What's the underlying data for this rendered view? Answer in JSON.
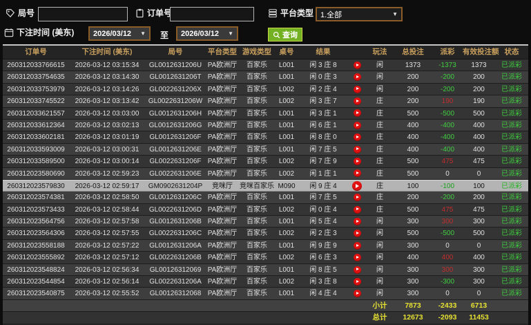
{
  "filters": {
    "round_label": "局号",
    "order_label": "订单号",
    "platform_label": "平台类型",
    "platform_value": "1.全部",
    "bet_time_label": "下注时间 (美东)",
    "date_from": "2026/03/12",
    "date_to": "2026/03/12",
    "to_label": "至",
    "search_label": "查询"
  },
  "icons": {
    "round": "tag-icon",
    "order": "clipboard-icon",
    "platform": "database-icon",
    "bet_time": "calendar-icon",
    "search": "magnifier-icon",
    "result_row": "play-icon",
    "select": "chevron-down-icon"
  },
  "colors": {
    "header_text": "#c9a05e",
    "win_red": "#c22c2c",
    "lose_green": "#3fcf3f",
    "status_green": "#3fcf3f",
    "totals_yellow": "#e5e032",
    "date_border": "#8a5c28",
    "search_green": "#74b122",
    "highlight_row": "#b4b4b4"
  },
  "table": {
    "headers": [
      "订单号",
      "下注时间 (美东)",
      "局号",
      "平台类型",
      "游戏类型",
      "桌号",
      "结果",
      "",
      "玩法",
      "总投注",
      "派彩",
      "有效投注额",
      "状态"
    ],
    "highlighted_row_index": 10,
    "rows": [
      {
        "order": "260312033766615",
        "time": "2026-03-12 03:15:34",
        "round": "GL0012631206U",
        "platform": "PA欧洲厅",
        "game": "百家乐",
        "table": "L001",
        "result": "闲 3 庄 8",
        "playtype": "闲",
        "bet": "1373",
        "payout": "-1373",
        "valid": "1373",
        "status": "已派彩"
      },
      {
        "order": "260312033754635",
        "time": "2026-03-12 03:14:30",
        "round": "GL0012631206T",
        "platform": "PA欧洲厅",
        "game": "百家乐",
        "table": "L001",
        "result": "闲 0 庄 3",
        "playtype": "闲",
        "bet": "200",
        "payout": "-200",
        "valid": "200",
        "status": "已派彩"
      },
      {
        "order": "260312033753979",
        "time": "2026-03-12 03:14:26",
        "round": "GL0022631206X",
        "platform": "PA欧洲厅",
        "game": "百家乐",
        "table": "L002",
        "result": "闲 2 庄 4",
        "playtype": "闲",
        "bet": "200",
        "payout": "-200",
        "valid": "200",
        "status": "已派彩"
      },
      {
        "order": "260312033745522",
        "time": "2026-03-12 03:13:42",
        "round": "GL0022631206W",
        "platform": "PA欧洲厅",
        "game": "百家乐",
        "table": "L002",
        "result": "闲 3 庄 7",
        "playtype": "庄",
        "bet": "200",
        "payout": "190",
        "valid": "190",
        "status": "已派彩"
      },
      {
        "order": "260312033621557",
        "time": "2026-03-12 03:03:00",
        "round": "GL0012631206H",
        "platform": "PA欧洲厅",
        "game": "百家乐",
        "table": "L001",
        "result": "闲 3 庄 1",
        "playtype": "庄",
        "bet": "500",
        "payout": "-500",
        "valid": "500",
        "status": "已派彩"
      },
      {
        "order": "260312033612364",
        "time": "2026-03-12 03:02:13",
        "round": "GL0012631206G",
        "platform": "PA欧洲厅",
        "game": "百家乐",
        "table": "L001",
        "result": "闲 6 庄 1",
        "playtype": "庄",
        "bet": "400",
        "payout": "-400",
        "valid": "400",
        "status": "已派彩"
      },
      {
        "order": "260312033602181",
        "time": "2026-03-12 03:01:19",
        "round": "GL0012631206F",
        "platform": "PA欧洲厅",
        "game": "百家乐",
        "table": "L001",
        "result": "闲 8 庄 0",
        "playtype": "庄",
        "bet": "400",
        "payout": "-400",
        "valid": "400",
        "status": "已派彩"
      },
      {
        "order": "260312033593009",
        "time": "2026-03-12 03:00:31",
        "round": "GL0012631206E",
        "platform": "PA欧洲厅",
        "game": "百家乐",
        "table": "L001",
        "result": "闲 7 庄 5",
        "playtype": "庄",
        "bet": "400",
        "payout": "-400",
        "valid": "400",
        "status": "已派彩"
      },
      {
        "order": "260312033589500",
        "time": "2026-03-12 03:00:14",
        "round": "GL0022631206F",
        "platform": "PA欧洲厅",
        "game": "百家乐",
        "table": "L002",
        "result": "闲 7 庄 9",
        "playtype": "庄",
        "bet": "500",
        "payout": "475",
        "valid": "475",
        "status": "已派彩"
      },
      {
        "order": "260312023580690",
        "time": "2026-03-12 02:59:23",
        "round": "GL0022631206E",
        "platform": "PA欧洲厅",
        "game": "百家乐",
        "table": "L002",
        "result": "闲 1 庄 1",
        "playtype": "庄",
        "bet": "500",
        "payout": "0",
        "valid": "0",
        "status": "已派彩"
      },
      {
        "order": "260312023579830",
        "time": "2026-03-12 02:59:17",
        "round": "GM0902631204P",
        "platform": "竞咪厅",
        "game": "竞咪百家乐",
        "table": "M090",
        "result": "闲 9 庄 4",
        "playtype": "庄",
        "bet": "100",
        "payout": "-100",
        "valid": "100",
        "status": "已派彩"
      },
      {
        "order": "260312023574381",
        "time": "2026-03-12 02:58:50",
        "round": "GL0012631206C",
        "platform": "PA欧洲厅",
        "game": "百家乐",
        "table": "L001",
        "result": "闲 7 庄 5",
        "playtype": "庄",
        "bet": "200",
        "payout": "-200",
        "valid": "200",
        "status": "已派彩"
      },
      {
        "order": "260312023573433",
        "time": "2026-03-12 02:58:44",
        "round": "GL0022631206D",
        "platform": "PA欧洲厅",
        "game": "百家乐",
        "table": "L002",
        "result": "闲 0 庄 4",
        "playtype": "庄",
        "bet": "500",
        "payout": "475",
        "valid": "475",
        "status": "已派彩"
      },
      {
        "order": "260312023564756",
        "time": "2026-03-12 02:57:58",
        "round": "GL0012631206B",
        "platform": "PA欧洲厅",
        "game": "百家乐",
        "table": "L001",
        "result": "闲 5 庄 4",
        "playtype": "闲",
        "bet": "300",
        "payout": "300",
        "valid": "300",
        "status": "已派彩"
      },
      {
        "order": "260312023564306",
        "time": "2026-03-12 02:57:55",
        "round": "GL0022631206C",
        "platform": "PA欧洲厅",
        "game": "百家乐",
        "table": "L002",
        "result": "闲 2 庄 3",
        "playtype": "闲",
        "bet": "500",
        "payout": "-500",
        "valid": "500",
        "status": "已派彩"
      },
      {
        "order": "260312023558188",
        "time": "2026-03-12 02:57:22",
        "round": "GL0012631206A",
        "platform": "PA欧洲厅",
        "game": "百家乐",
        "table": "L001",
        "result": "闲 9 庄 9",
        "playtype": "闲",
        "bet": "300",
        "payout": "0",
        "valid": "0",
        "status": "已派彩"
      },
      {
        "order": "260312023555892",
        "time": "2026-03-12 02:57:12",
        "round": "GL0022631206B",
        "platform": "PA欧洲厅",
        "game": "百家乐",
        "table": "L002",
        "result": "闲 6 庄 3",
        "playtype": "闲",
        "bet": "400",
        "payout": "400",
        "valid": "400",
        "status": "已派彩"
      },
      {
        "order": "260312023548824",
        "time": "2026-03-12 02:56:34",
        "round": "GL00126312069",
        "platform": "PA欧洲厅",
        "game": "百家乐",
        "table": "L001",
        "result": "闲 8 庄 5",
        "playtype": "闲",
        "bet": "300",
        "payout": "300",
        "valid": "300",
        "status": "已派彩"
      },
      {
        "order": "260312023544854",
        "time": "2026-03-12 02:56:14",
        "round": "GL0022631206A",
        "platform": "PA欧洲厅",
        "game": "百家乐",
        "table": "L002",
        "result": "闲 3 庄 8",
        "playtype": "闲",
        "bet": "300",
        "payout": "-300",
        "valid": "300",
        "status": "已派彩"
      },
      {
        "order": "260312023540875",
        "time": "2026-03-12 02:55:52",
        "round": "GL00126312068",
        "platform": "PA欧洲厅",
        "game": "百家乐",
        "table": "L001",
        "result": "闲 4 庄 4",
        "playtype": "闲",
        "bet": "300",
        "payout": "0",
        "valid": "0",
        "status": "已派彩"
      }
    ],
    "subtotal": {
      "label": "小计",
      "bet": "7873",
      "payout": "-2433",
      "valid": "6713"
    },
    "total": {
      "label": "总计",
      "bet": "12673",
      "payout": "-2093",
      "valid": "11453"
    }
  }
}
